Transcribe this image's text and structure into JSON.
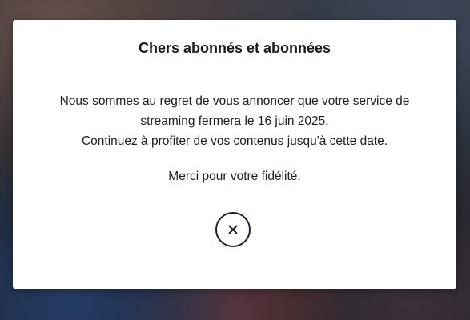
{
  "modal": {
    "title": "Chers abonnés et abonnées",
    "body_lines": [
      "Nous sommes au regret de vous annoncer que votre service de",
      "streaming fermera le 16 juin 2025.",
      "Continuez à profiter de vos contenus jusqu'à cette date."
    ],
    "thanks": "Merci pour votre fidélité.",
    "close_icon": "close-icon"
  },
  "colors": {
    "modal_background": "#ffffff",
    "text": "#1b1b1b",
    "close_border": "#1c2230"
  }
}
